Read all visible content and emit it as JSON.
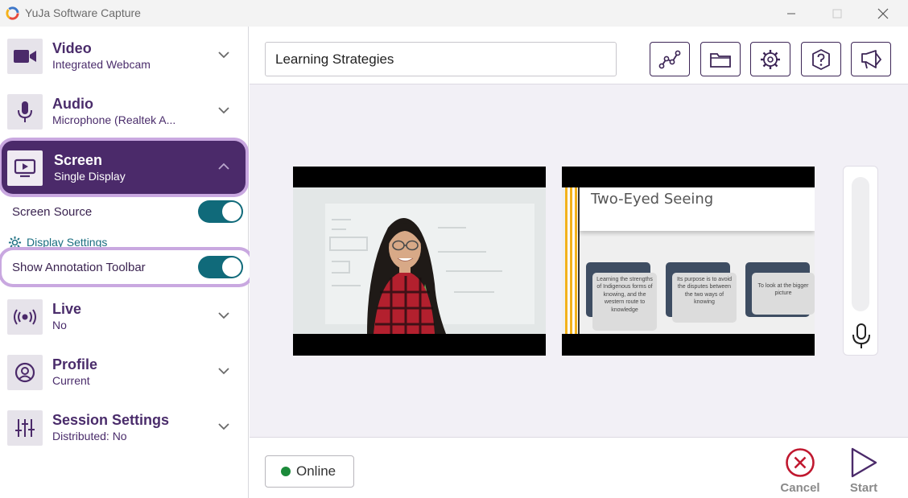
{
  "window": {
    "title": "YuJa Software Capture"
  },
  "sidebar": {
    "video": {
      "title": "Video",
      "subtitle": "Integrated Webcam"
    },
    "audio": {
      "title": "Audio",
      "subtitle": "Microphone (Realtek A..."
    },
    "screen": {
      "title": "Screen",
      "subtitle": "Single Display"
    },
    "screen_source": {
      "label": "Screen Source",
      "on": true
    },
    "display_settings": {
      "label": "Display Settings"
    },
    "annotation": {
      "label": "Show Annotation Toolbar",
      "on": true
    },
    "live": {
      "title": "Live",
      "subtitle": "No"
    },
    "profile": {
      "title": "Profile",
      "subtitle": "Current"
    },
    "session": {
      "title": "Session Settings",
      "subtitle": "Distributed: No"
    }
  },
  "main": {
    "session_title": "Learning Strategies",
    "toolbar_icons": [
      "analytics-icon",
      "folder-icon",
      "settings-icon",
      "help-icon",
      "announcement-icon"
    ],
    "slide": {
      "heading": "Two-Eyed Seeing",
      "cards": [
        "Learning the strengths of Indigenous forms of knowing, and the western route to knowledge",
        "Its purpose is to avoid the disputes between the two ways of knowing",
        "To look at the bigger picture"
      ]
    }
  },
  "footer": {
    "status": "Online",
    "cancel_label": "Cancel",
    "start_label": "Start"
  },
  "colors": {
    "brand": "#4b2a6a",
    "accent": "#c9a8e0",
    "toggle": "#106a7a",
    "cancel": "#c0182f",
    "online": "#1b8a3a"
  }
}
